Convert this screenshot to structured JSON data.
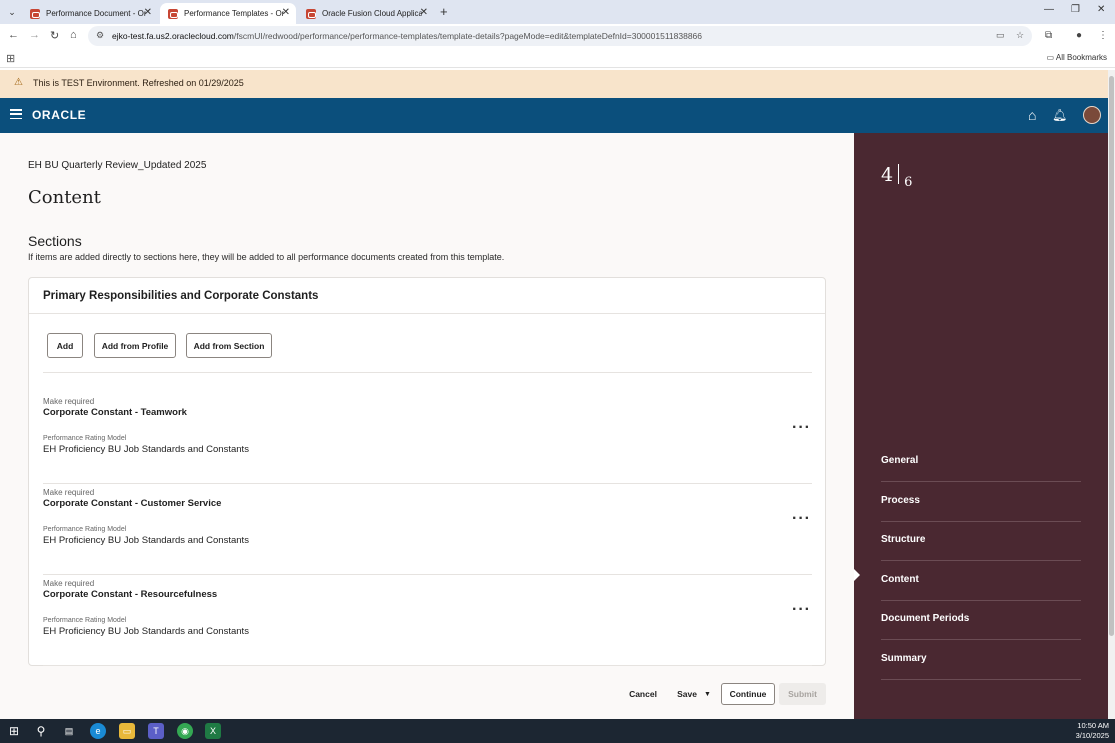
{
  "browser": {
    "tabs": [
      {
        "title": "Performance Document - Oracle",
        "active": false
      },
      {
        "title": "Performance Templates - Oracle",
        "active": true
      },
      {
        "title": "Oracle Fusion Cloud Applications",
        "active": false
      }
    ],
    "url_host": "ejko-test.fa.us2.oraclecloud.com",
    "url_path": "/fscmUI/redwood/performance/performance-templates/template-details?pageMode=edit&templateDefnId=300001511838866",
    "all_bookmarks": "All Bookmarks"
  },
  "banner": {
    "text": "This is TEST Environment. Refreshed on 01/29/2025",
    "icon": "warning-icon"
  },
  "header": {
    "logo": "ORACLE"
  },
  "main": {
    "template_name": "EH BU Quarterly Review_Updated 2025",
    "page_title": "Content",
    "sections_title": "Sections",
    "sections_desc": "If items are added directly to sections here, they will be added to all performance documents created from this template.",
    "section": {
      "title": "Primary Responsibilities and Corporate Constants",
      "buttons": {
        "add": "Add",
        "add_profile": "Add from Profile",
        "add_section": "Add from Section"
      },
      "items": [
        {
          "required_label": "Make required",
          "name": "Corporate Constant - Teamwork",
          "rating_label": "Performance Rating Model",
          "rating": "EH Proficiency BU Job Standards and Constants"
        },
        {
          "required_label": "Make required",
          "name": "Corporate Constant - Customer Service",
          "rating_label": "Performance Rating Model",
          "rating": "EH Proficiency BU Job Standards and Constants"
        },
        {
          "required_label": "Make required",
          "name": "Corporate Constant - Resourcefulness",
          "rating_label": "Performance Rating Model",
          "rating": "EH Proficiency BU Job Standards and Constants"
        }
      ]
    },
    "footer": {
      "cancel": "Cancel",
      "save": "Save",
      "continue": "Continue",
      "submit": "Submit"
    }
  },
  "train": {
    "current": "4",
    "total": "6",
    "steps": [
      "General",
      "Process",
      "Structure",
      "Content",
      "Document Periods",
      "Summary"
    ],
    "active_step": "Content"
  },
  "taskbar": {
    "time": "10:50 AM",
    "date": "3/10/2025"
  },
  "colors": {
    "header": "#0b4f7c",
    "train": "#4a2831",
    "banner": "#f8e4cb"
  }
}
